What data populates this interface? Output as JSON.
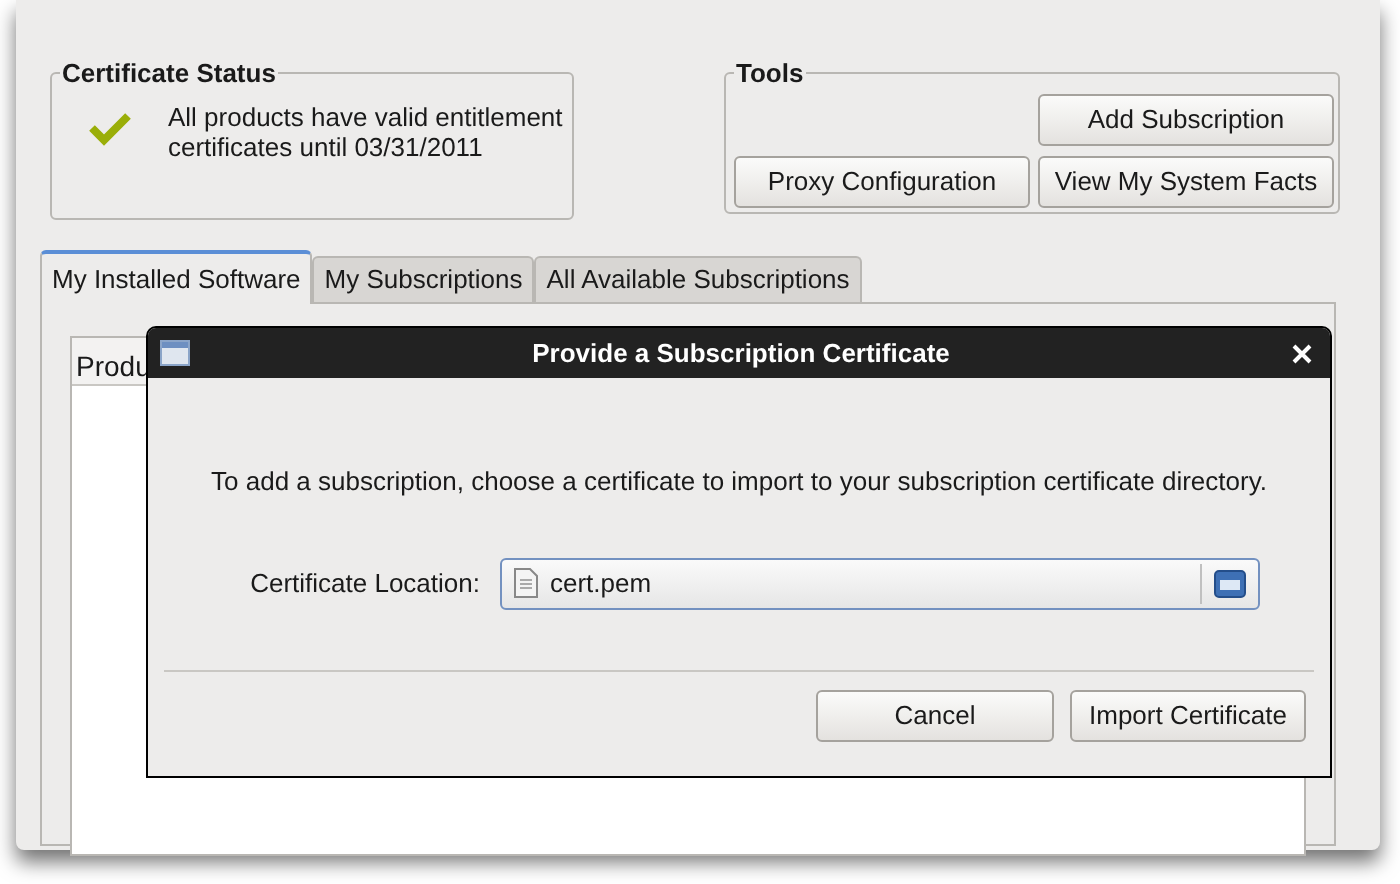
{
  "certificate_status": {
    "title": "Certificate Status",
    "valid": true,
    "message": "All products have valid entitlement certificates until 03/31/2011"
  },
  "tools": {
    "title": "Tools",
    "buttons": [
      "Add Subscription",
      "Proxy Configuration",
      "View My System Facts"
    ]
  },
  "tabs": [
    {
      "label": "My Installed Software",
      "selected": true
    },
    {
      "label": "My Subscriptions",
      "selected": false
    },
    {
      "label": "All Available Subscriptions",
      "selected": false
    }
  ],
  "table": {
    "columns": [
      "Produ"
    ]
  },
  "dialog": {
    "title": "Provide a Subscription Certificate",
    "message": "To add a subscription, choose a certificate to import to your subscription certificate directory.",
    "field_label": "Certificate Location:",
    "field_value": "cert.pem",
    "buttons": [
      "Cancel",
      "Import Certificate"
    ]
  }
}
